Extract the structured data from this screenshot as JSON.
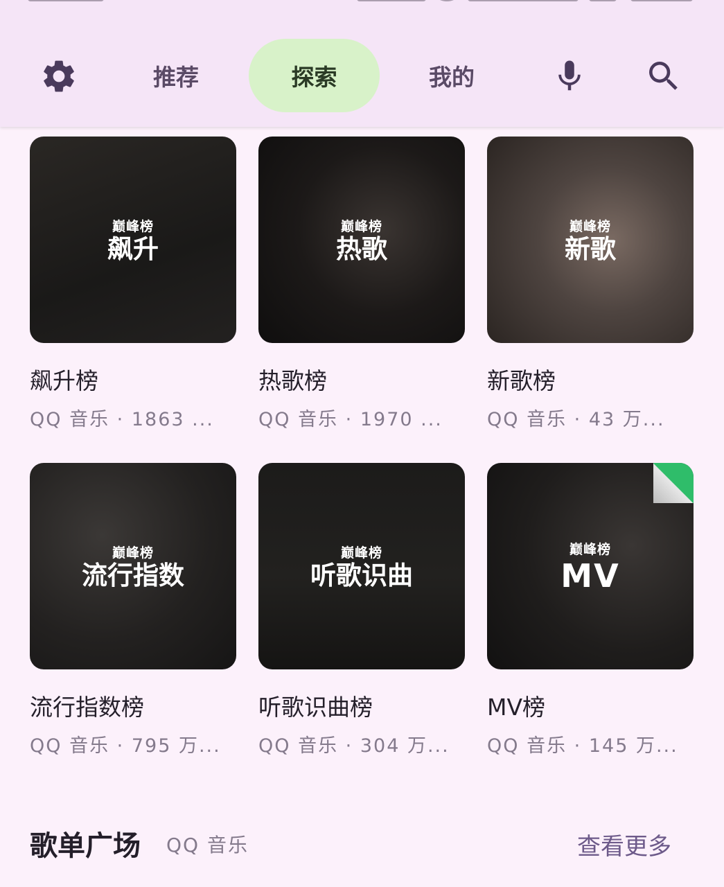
{
  "header": {
    "tabs": [
      {
        "label": "推荐",
        "active": false
      },
      {
        "label": "探索",
        "active": true
      },
      {
        "label": "我的",
        "active": false
      }
    ],
    "icons": {
      "settings": "gear-icon",
      "voice": "microphone-icon",
      "search": "search-icon"
    },
    "colors": {
      "header_bg": "#f5e5f7",
      "active_tab_bg": "#d8f2c9",
      "icon": "#4a3a5c"
    }
  },
  "charts": [
    {
      "cover_logo": "巅峰榜",
      "cover_title": "飙升",
      "name": "飙升榜",
      "subtitle": "QQ 音乐 · 1863 ..."
    },
    {
      "cover_logo": "巅峰榜",
      "cover_title": "热歌",
      "name": "热歌榜",
      "subtitle": "QQ 音乐 · 1970 ..."
    },
    {
      "cover_logo": "巅峰榜",
      "cover_title": "新歌",
      "name": "新歌榜",
      "subtitle": "QQ 音乐 · 43 万..."
    },
    {
      "cover_logo": "巅峰榜",
      "cover_title": "流行指数",
      "name": "流行指数榜",
      "subtitle": "QQ 音乐 · 795 万..."
    },
    {
      "cover_logo": "巅峰榜",
      "cover_title": "听歌识曲",
      "name": "听歌识曲榜",
      "subtitle": "QQ 音乐 · 304 万..."
    },
    {
      "cover_logo": "巅峰榜",
      "cover_title": "MV",
      "name": "MV榜",
      "subtitle": "QQ 音乐 · 145 万..."
    }
  ],
  "playlist_section": {
    "title": "歌单广场",
    "subtitle": "QQ 音乐",
    "more_label": "查看更多"
  }
}
